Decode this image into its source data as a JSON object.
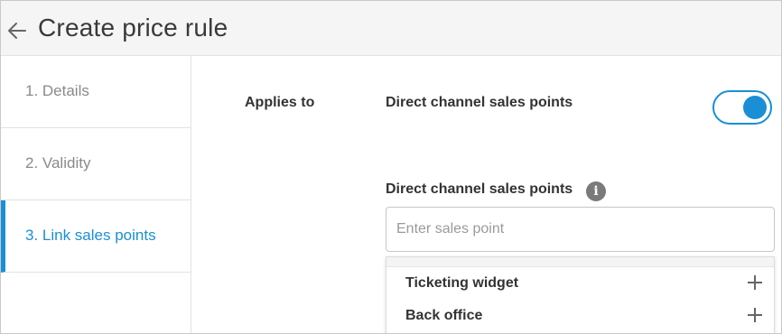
{
  "header": {
    "title": "Create price rule"
  },
  "steps": [
    {
      "label": "1. Details",
      "active": false
    },
    {
      "label": "2. Validity",
      "active": false
    },
    {
      "label": "3. Link sales points",
      "active": true
    }
  ],
  "form": {
    "applies_to_label": "Applies to",
    "toggle_label": "Direct channel sales points",
    "toggle_on": true,
    "field_label": "Direct channel sales points",
    "search_placeholder": "Enter sales point",
    "search_value": "",
    "options": [
      {
        "label": "Ticketing widget"
      },
      {
        "label": "Back office"
      }
    ]
  },
  "colors": {
    "accent": "#1a8fd6",
    "muted_text": "#8a8a8a"
  },
  "icons": {
    "back": "arrow-left",
    "info": "info-circle",
    "add": "plus"
  }
}
